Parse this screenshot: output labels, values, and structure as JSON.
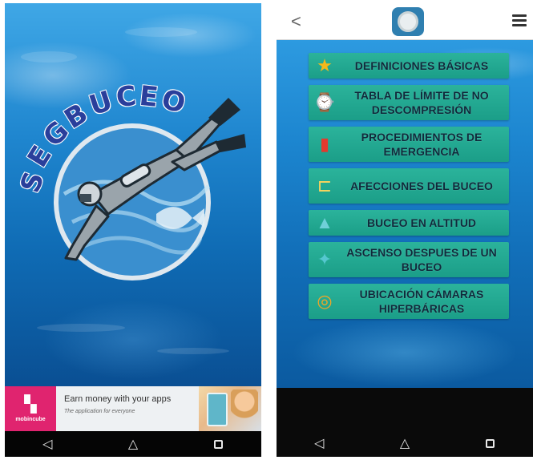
{
  "splash": {
    "logo_text": "SEGBUCEO",
    "logo_letters": [
      "S",
      "E",
      "G",
      "B",
      "U",
      "C",
      "E",
      "O"
    ]
  },
  "ad": {
    "brand_icon": "chat-bubble-icon",
    "brand_label": "mobincube",
    "title": "Earn money with your apps",
    "subtitle": "The application for everyone"
  },
  "nav": {
    "back_icon": "◁",
    "home_icon": "△",
    "recents_icon": "square"
  },
  "menu_screen": {
    "back_label": "<",
    "app_icon": "dive-gauge-icon",
    "menu_icon": "hamburger-icon",
    "items": [
      {
        "label": "DEFINICIONES BÁSICAS",
        "icon": "star-icon",
        "glyph": "★",
        "glyph_color": "#f5b81b"
      },
      {
        "label": "TABLA DE LÍMITE DE NO DESCOMPRESIÓN",
        "icon": "dive-computer-icon",
        "glyph": "⌚",
        "glyph_color": "#dfe6ea"
      },
      {
        "label": "PROCEDIMIENTOS DE EMERGENCIA",
        "icon": "oxygen-kit-icon",
        "glyph": "▮",
        "glyph_color": "#e23a2e"
      },
      {
        "label": "AFECCIONES DEL BUCEO",
        "icon": "syringe-icon",
        "glyph": "⊏",
        "glyph_color": "#f4d35e"
      },
      {
        "label": "BUCEO EN ALTITUD",
        "icon": "fins-icon",
        "glyph": "▲",
        "glyph_color": "#6fd0d8"
      },
      {
        "label": "ASCENSO DESPUES DE UN BUCEO",
        "icon": "diver-icon",
        "glyph": "✦",
        "glyph_color": "#55c7cf"
      },
      {
        "label": "UBICACIÓN CÁMARAS HIPERBÁRICAS",
        "icon": "location-ring-icon",
        "glyph": "◎",
        "glyph_color": "#f5a623"
      }
    ]
  }
}
